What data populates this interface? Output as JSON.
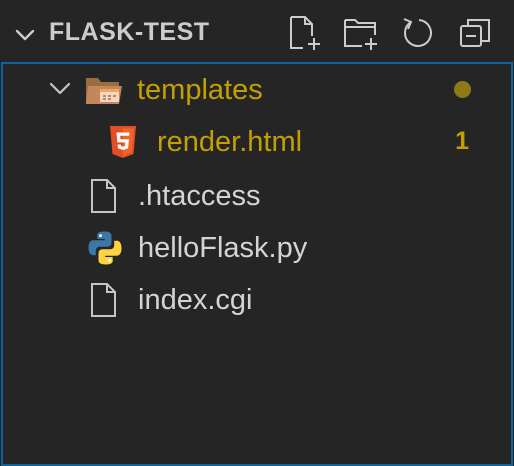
{
  "explorer": {
    "folder_title": "FLASK-TEST",
    "actions": [
      {
        "name": "new-file-icon"
      },
      {
        "name": "new-folder-icon"
      },
      {
        "name": "refresh-icon"
      },
      {
        "name": "collapse-all-icon"
      }
    ]
  },
  "tree": {
    "templates": {
      "label": "templates",
      "icon": "folder-templates-icon",
      "badge": "modified-dot"
    },
    "render": {
      "label": "render.html",
      "icon": "html5-icon",
      "badge": "1"
    },
    "htaccess": {
      "label": ".htaccess",
      "icon": "file-icon"
    },
    "hello": {
      "label": "helloFlask.py",
      "icon": "python-icon"
    },
    "index": {
      "label": "index.cgi",
      "icon": "file-icon"
    }
  },
  "colors": {
    "background": "#252526",
    "focus_border": "#0e639c",
    "modified_text": "#c2a000",
    "text": "#d4d4d4"
  }
}
